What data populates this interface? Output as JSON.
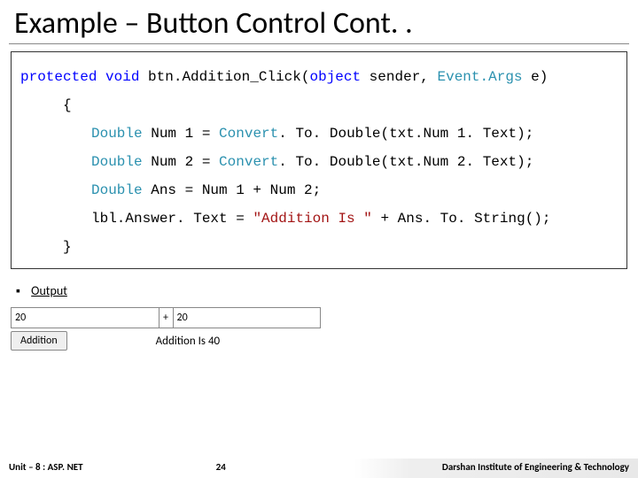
{
  "title": "Example – Button Control Cont. .",
  "code": {
    "line1": {
      "kw1": "protected",
      "kw2": "void",
      "mid": " btn.Addition_Click(",
      "kw3": "object",
      "mid2": " sender, ",
      "cls1": "Event.Args",
      "end": " e)"
    },
    "brace_open": "{",
    "l2": {
      "cls": "Double",
      "rest": " Num 1 = ",
      "cls2": "Convert",
      "rest2": ". To. Double(txt.Num 1. Text);"
    },
    "l3": {
      "cls": "Double",
      "rest": " Num 2 = ",
      "cls2": "Convert",
      "rest2": ". To. Double(txt.Num 2. Text);"
    },
    "l4": {
      "cls": "Double",
      "rest": " Ans = Num 1 + Num 2;"
    },
    "l5": {
      "pre": "lbl.Answer. Text = ",
      "str": "\"Addition Is \"",
      "post": " + Ans. To. String();"
    },
    "brace_close": "}"
  },
  "output_section": {
    "bullet": "▪",
    "label": "Output"
  },
  "demo": {
    "input1": "20",
    "plus": "+",
    "input2": "20",
    "button": "Addition",
    "result": "Addition Is 40"
  },
  "footer": {
    "left": "Unit – 8 : ASP. NET",
    "center": "24",
    "right": "Darshan Institute of Engineering & Technology"
  }
}
